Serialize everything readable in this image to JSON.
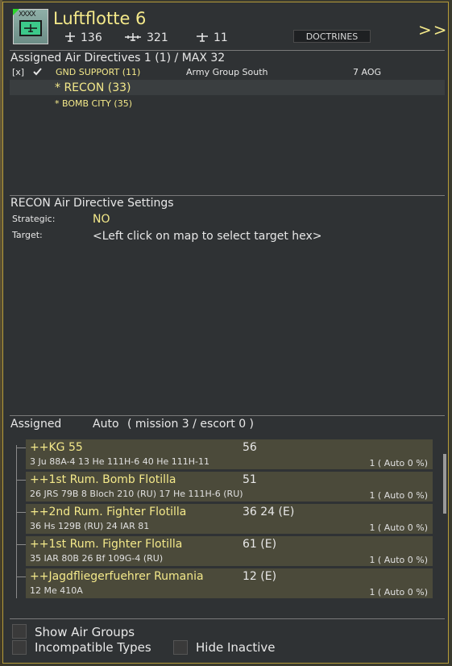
{
  "header": {
    "title": "Luftflotte 6",
    "counts": [
      {
        "icon": "bomber-icon",
        "value": "136"
      },
      {
        "icon": "transport-icon",
        "value": "321"
      },
      {
        "icon": "fighter-icon",
        "value": "11"
      }
    ],
    "doctrines_label": "DOCTRINES",
    "expand_label": ">>"
  },
  "directives": {
    "heading": "Assigned Air Directives 1 (1) / MAX 32",
    "row": {
      "checkbox": "[x]",
      "mission": "GND SUPPORT (11)",
      "target": "Army Group South",
      "aog": "7 AOG"
    },
    "sub_items": [
      {
        "label": "* RECON (33)"
      },
      {
        "label": "* BOMB CITY (35)"
      }
    ]
  },
  "settings": {
    "heading": "RECON Air Directive Settings",
    "strategic_label": "Strategic:",
    "strategic_value": "NO",
    "target_label": "Target:",
    "target_value": "<Left click on map to select target hex>"
  },
  "assigned": {
    "label": "Assigned",
    "auto_label": "Auto",
    "mission_info": "( mission 3 / escort 0 )",
    "units": [
      {
        "name": "++KG 55",
        "num": "56",
        "aircraft": "3 Ju 88A-4   13 He 111H-6   40 He 111H-11",
        "auto": "1  ( Auto 0 %)"
      },
      {
        "name": "++1st Rum. Bomb Flotilla",
        "num": "51",
        "aircraft": "26 JRS 79B   8 Bloch 210 (RU)   17 He 111H-6 (RU)",
        "auto": "1  ( Auto 0 %)"
      },
      {
        "name": "++2nd Rum. Fighter Flotilla",
        "num": "36   24 (E)",
        "aircraft": "36 Hs 129B (RU)   24 IAR 81",
        "auto": "1  ( Auto 0 %)"
      },
      {
        "name": "++1st Rum. Fighter Flotilla",
        "num": "61 (E)",
        "aircraft": "35 IAR 80B   26 Bf 109G-4 (RU)",
        "auto": "1  ( Auto 0 %)"
      },
      {
        "name": "++Jagdfliegerfuehrer Rumania",
        "num": "12 (E)",
        "aircraft": "12 Me 410A",
        "auto": "1  ( Auto 0 %)"
      }
    ]
  },
  "options": {
    "show_air_groups": "Show Air Groups",
    "incompatible_types": "Incompatible Types",
    "hide_inactive": "Hide Inactive"
  },
  "colors": {
    "accent": "#f4e98a",
    "panel": "#2f3234",
    "border": "#b59b3a"
  }
}
